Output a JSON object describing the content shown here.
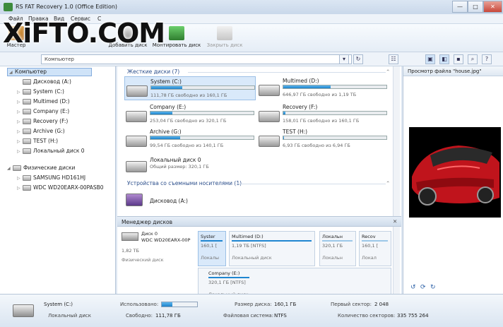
{
  "window": {
    "title": "RS FAT Recovery 1.0 (Office Edition)",
    "min": "—",
    "max": "□",
    "close": "✕"
  },
  "menu": [
    "Файл",
    "Правка",
    "Вид",
    "Сервис",
    "С"
  ],
  "toolbar": {
    "master": "Мастер",
    "add_disk": "Добавить диск",
    "mount_disk": "Монтировать диск",
    "close_disk": "Закрыть диск"
  },
  "address": {
    "value": "Компьютер"
  },
  "tree": {
    "root": "Компьютер",
    "items": [
      "Дисковод (A:)",
      "System (C:)",
      "Multimed (D:)",
      "Company (E:)",
      "Recovery (F:)",
      "Archive (G:)",
      "TEST (H:)",
      "Локальный диск 0"
    ],
    "physical_header": "Физические диски",
    "physical": [
      "SAMSUNG HD161HJ",
      "WDC WD20EARX-00PASB0"
    ]
  },
  "hard_disks": {
    "header": "Жесткие диски (7)",
    "disks": [
      {
        "name": "System (C:)",
        "info": "111,78 ГБ свободно из 160,1 ГБ",
        "used": 0.3
      },
      {
        "name": "Multimed (D:)",
        "info": "646,97 ГБ свободно из 1,19 ТБ",
        "used": 0.46
      },
      {
        "name": "Company (E:)",
        "info": "253,04 ГБ свободно из 320,1 ГБ",
        "used": 0.21
      },
      {
        "name": "Recovery (F:)",
        "info": "158,01 ГБ свободно из 160,1 ГБ",
        "used": 0.02
      },
      {
        "name": "Archive (G:)",
        "info": "99,54 ГБ свободно из 140,1 ГБ",
        "used": 0.29
      },
      {
        "name": "TEST (H:)",
        "info": "6,93 ГБ свободно из 6,94 ГБ",
        "used": 0.01
      }
    ],
    "local": {
      "name": "Локальный диск 0",
      "info": "Общий размер: 320,1 ГБ"
    }
  },
  "removable": {
    "header": "Устройства со съемными носителями (1)",
    "item": "Дисковод (A:)"
  },
  "disk_manager": {
    "header": "Менеджер дисков",
    "disk": {
      "name": "Диск 0",
      "model": "WDC WD20EARX-00P",
      "size": "1,82 ТБ",
      "type": "Физический диск"
    },
    "partitions": [
      {
        "name": "Syster",
        "size": "160,1 [",
        "type": "Локалы"
      },
      {
        "name": "Multimed (D:)",
        "size": "1,19 ТБ [NTFS]",
        "type": "Локальный диск"
      },
      {
        "name": "Локальн",
        "size": "320,1 ГБ",
        "type": "Локальн"
      },
      {
        "name": "Recov",
        "size": "160,1 [",
        "type": "Локал"
      },
      {
        "name": "Company (E:)",
        "size": "320,1 ГБ [NTFS]",
        "type": "Локальный диск"
      }
    ]
  },
  "preview": {
    "title": "Просмотр файла \"house.jpg\""
  },
  "status": {
    "disk_name": "System (C:)",
    "disk_type": "Локальный диск",
    "used_label": "Использовано:",
    "used_fraction": 0.3,
    "free_label": "Свободно:",
    "free_value": "111,78 ГБ",
    "size_label": "Размер диска:",
    "size_value": "160,1 ГБ",
    "fs_label": "Файловая система:",
    "fs_value": "NTFS",
    "first_sector_label": "Первый сектор:",
    "first_sector_value": "2 048",
    "sector_count_label": "Количество секторов:",
    "sector_count_value": "335 755 264"
  },
  "watermark": "XiFTO.COM"
}
